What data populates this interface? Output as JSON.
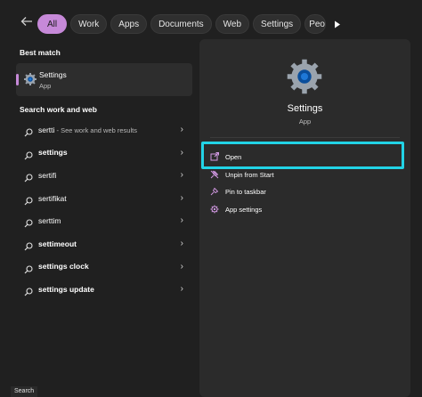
{
  "topbar": {
    "back_icon": "back-arrow-icon",
    "filters": [
      "All",
      "Work",
      "Apps",
      "Documents",
      "Web",
      "Settings",
      "Peo"
    ],
    "active_filter": "All",
    "more_icon": "play-icon"
  },
  "left": {
    "best_match_title": "Best match",
    "best_match": {
      "name": "Settings",
      "type": "App",
      "icon": "settings-gear-icon"
    },
    "search_section_title": "Search work and web",
    "results": [
      {
        "bold": "",
        "text": "sertti",
        "sub": " - See work and web results"
      },
      {
        "bold": "settings",
        "text": "",
        "sub": ""
      },
      {
        "bold": "",
        "text": "sertifi",
        "sub": ""
      },
      {
        "bold": "",
        "text": "sertifikat",
        "sub": ""
      },
      {
        "bold": "",
        "text": "serttim",
        "sub": ""
      },
      {
        "bold": "settimeout",
        "text": "",
        "sub": ""
      },
      {
        "bold": "settings clock",
        "text": "",
        "sub": ""
      },
      {
        "bold": "settings update",
        "text": "",
        "sub": ""
      }
    ]
  },
  "right": {
    "name": "Settings",
    "type": "App",
    "actions": [
      {
        "label": "Open",
        "icon": "open-external-icon"
      },
      {
        "label": "Unpin from Start",
        "icon": "unpin-icon"
      },
      {
        "label": "Pin to taskbar",
        "icon": "pin-icon"
      },
      {
        "label": "App settings",
        "icon": "gear-icon"
      }
    ]
  },
  "footer": {
    "label": "Search"
  },
  "colors": {
    "accent": "#c689d8",
    "highlight": "#22d3e6",
    "panel": "#2b2b2b",
    "background": "#202020"
  }
}
